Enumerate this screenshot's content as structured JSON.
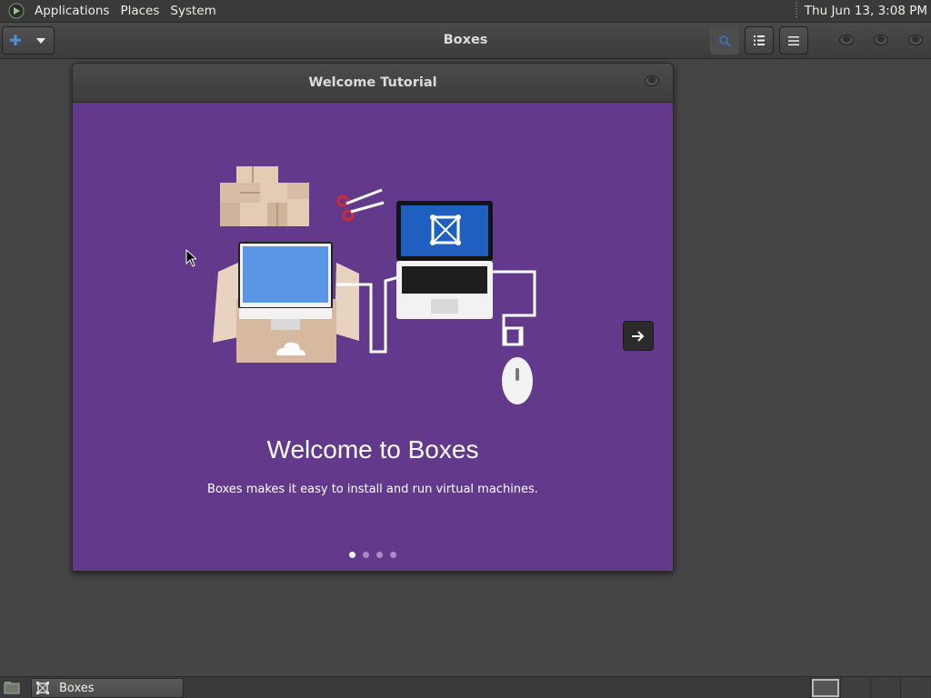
{
  "top_panel": {
    "menus": [
      "Applications",
      "Places",
      "System"
    ],
    "clock": "Thu Jun 13,  3:08 PM"
  },
  "headerbar": {
    "title": "Boxes",
    "new_button_icon": "plus-icon",
    "buttons": [
      "search-icon",
      "list-view-icon",
      "menu-icon"
    ]
  },
  "dialog": {
    "title": "Welcome Tutorial",
    "heading": "Welcome to Boxes",
    "description": "Boxes makes it easy to install and run virtual machines.",
    "page_count": 4,
    "current_page": 1,
    "background_color": "#633a8b"
  },
  "taskbar": {
    "window_label": "Boxes",
    "workspaces": 4,
    "active_workspace": 1
  }
}
